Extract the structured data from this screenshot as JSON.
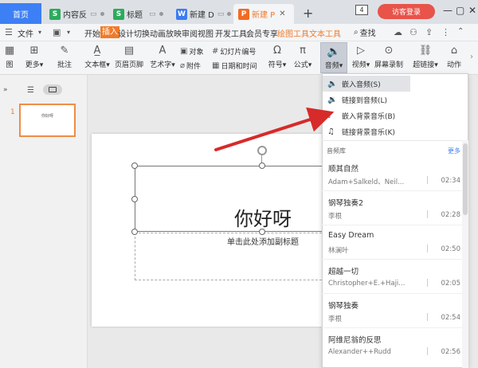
{
  "tabs": {
    "home": "首页",
    "docs": [
      {
        "type": "S",
        "label": "内容反"
      },
      {
        "type": "S",
        "label": "标题"
      },
      {
        "type": "W",
        "label": "新建 D"
      },
      {
        "type": "P",
        "label": "新建 P"
      }
    ],
    "plus": "+",
    "counter": "4",
    "login": "访客登录"
  },
  "window_controls": {
    "minimize": "—",
    "restore": "▢",
    "close": "✕"
  },
  "menubar": {
    "file": "文件",
    "items": [
      "开始",
      "插入",
      "设计",
      "切换",
      "动画",
      "放映",
      "审阅",
      "视图",
      "开发工具",
      "会员专享",
      "绘图工具",
      "文本工具"
    ],
    "active": "插入",
    "search": "查找"
  },
  "ribbon": {
    "more_left": "更多",
    "left_cut": "图",
    "comment": "批注",
    "textbox": "文本框",
    "header_footer": "页眉页脚",
    "wordart": "艺术字",
    "object": "对象",
    "slide_number": "幻灯片编号",
    "attachment": "附件",
    "datetime": "日期和时间",
    "symbol": "符号",
    "formula": "公式",
    "audio": "音频",
    "video": "视频",
    "screen_record": "屏幕录制",
    "hyperlink": "超链接",
    "action": "动作"
  },
  "slide_panel": {
    "slide_index": "1",
    "thumb_text": "你好呀"
  },
  "slide": {
    "title": "你好呀",
    "subtitle": "单击此处添加副标题"
  },
  "audio_menu": {
    "items": [
      "嵌入音频(S)",
      "链接到音频(L)",
      "嵌入背景音乐(B)",
      "链接背景音乐(K)"
    ],
    "library_label": "音频库",
    "more": "更多",
    "songs": [
      {
        "title": "顺其自然",
        "artist": "Adam+Salkeld、Neil...",
        "duration": "02:34"
      },
      {
        "title": "钢琴独奏2",
        "artist": "李根",
        "duration": "02:28"
      },
      {
        "title": "Easy Dream",
        "artist": "林澜叶",
        "duration": "02:50"
      },
      {
        "title": "超越一切",
        "artist": "Christopher+E.+Haji...",
        "duration": "02:05"
      },
      {
        "title": "钢琴独奏",
        "artist": "李根",
        "duration": "02:54"
      },
      {
        "title": "阿维尼翁的反思",
        "artist": "Alexander++Rudd",
        "duration": "02:56"
      }
    ]
  },
  "colors": {
    "accent_blue": "#3d7ff5",
    "accent_orange": "#f07b2a",
    "login_red": "#e8534a",
    "arrow_red": "#d72a2a"
  }
}
